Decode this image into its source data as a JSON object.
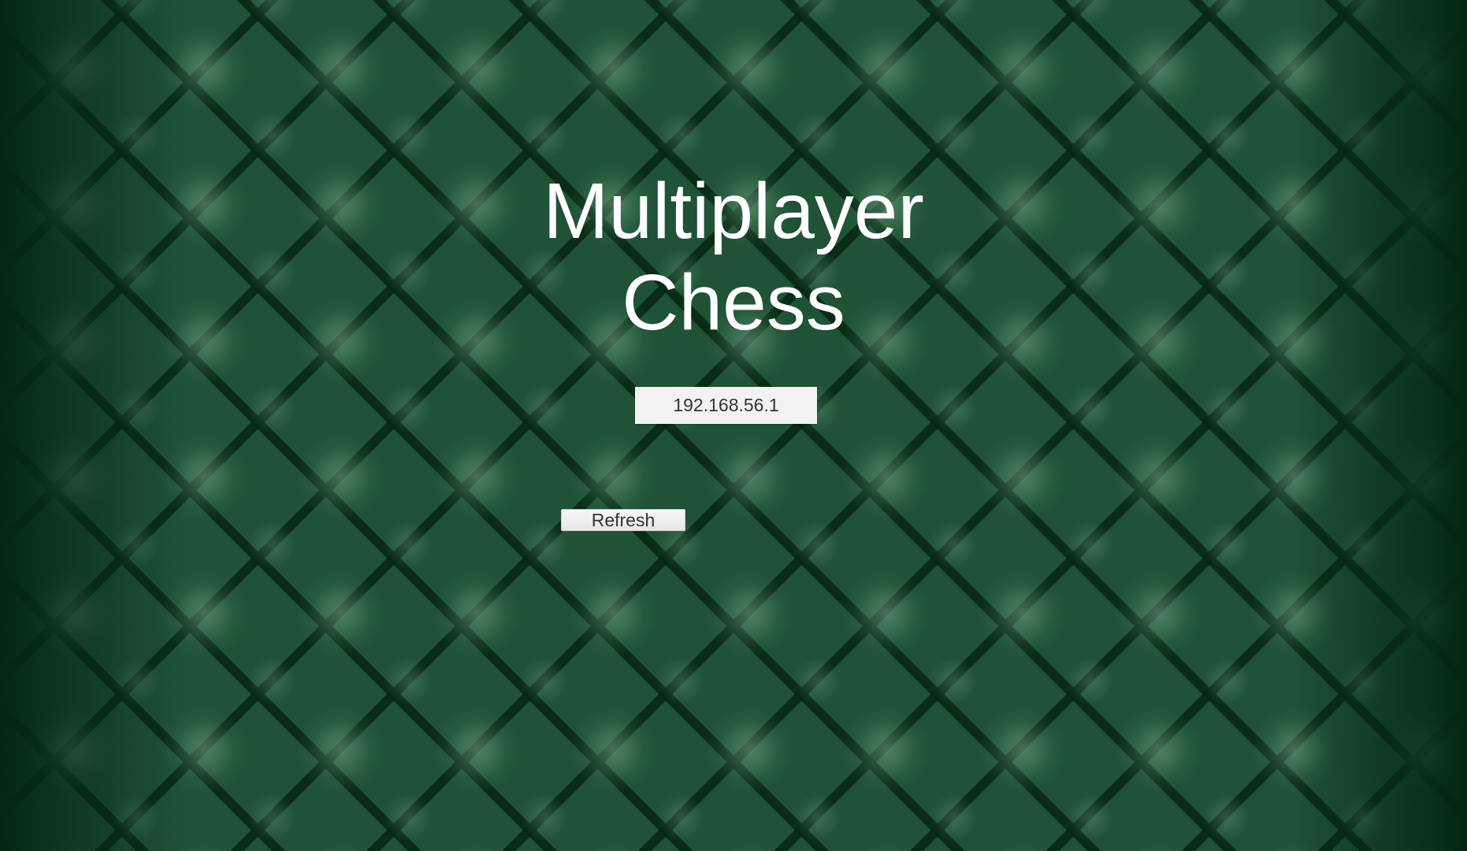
{
  "title": {
    "line1": "Multiplayer",
    "line2": "Chess"
  },
  "ip_field": {
    "value": "192.168.56.1"
  },
  "refresh_button": {
    "label": "Refresh"
  },
  "colors": {
    "background": "#1f5236",
    "background_dark": "#0f3a22",
    "title_text": "#ffffff",
    "field_background": "#f2f2f2",
    "field_text": "#333333"
  }
}
